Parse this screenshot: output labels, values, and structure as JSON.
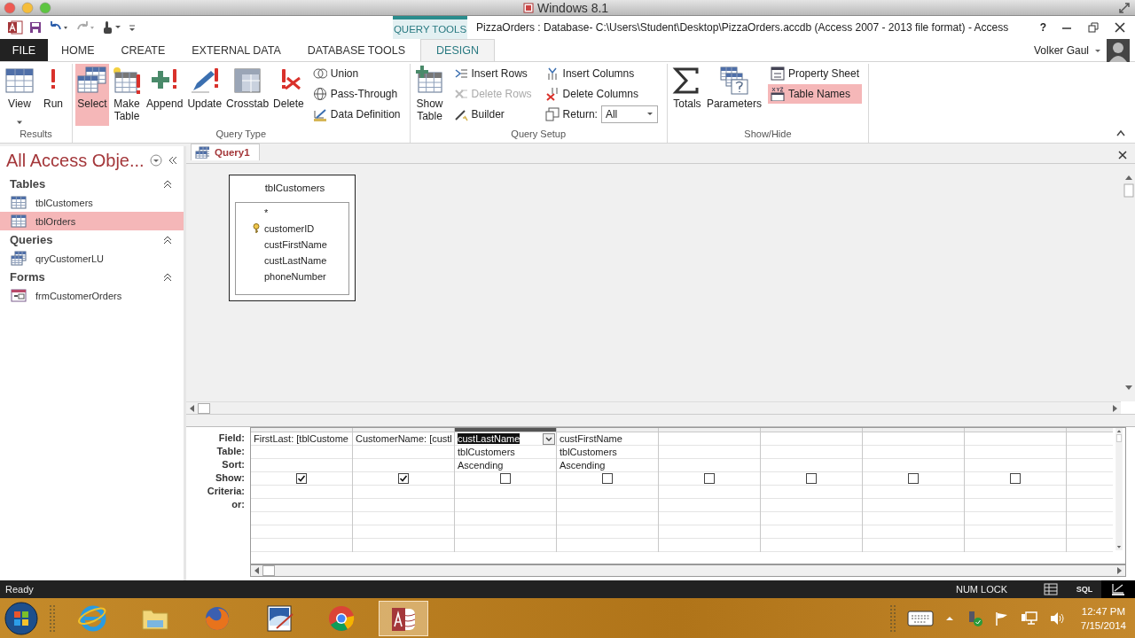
{
  "host_window": {
    "title": "Windows 8.1"
  },
  "title_bar": {
    "context_label": "QUERY TOOLS",
    "title": "PizzaOrders : Database- C:\\Users\\Student\\Desktop\\PizzaOrders.accdb (Access 2007 - 2013 file format) - Access",
    "help": "?"
  },
  "tabs": [
    {
      "label": "FILE",
      "kind": "file",
      "selected": false
    },
    {
      "label": "HOME",
      "kind": "normal",
      "selected": false
    },
    {
      "label": "CREATE",
      "kind": "normal",
      "selected": false
    },
    {
      "label": "EXTERNAL DATA",
      "kind": "normal",
      "selected": false
    },
    {
      "label": "DATABASE TOOLS",
      "kind": "normal",
      "selected": false
    },
    {
      "label": "DESIGN",
      "kind": "context",
      "selected": true
    }
  ],
  "account": {
    "user": "Volker Gaul"
  },
  "ribbon": {
    "groups": [
      {
        "label": "Results",
        "controls": [
          {
            "kind": "large",
            "label": "View",
            "dropdown": true,
            "selected": false,
            "disabled": false
          },
          {
            "kind": "large",
            "label": "Run",
            "dropdown": false,
            "selected": false,
            "disabled": false
          }
        ]
      },
      {
        "label": "Query Type",
        "controls": [
          {
            "kind": "large",
            "label": "Select",
            "dropdown": false,
            "selected": true,
            "disabled": false
          },
          {
            "kind": "large",
            "label": "Make Table",
            "dropdown": false,
            "selected": false,
            "disabled": false
          },
          {
            "kind": "large",
            "label": "Append",
            "dropdown": false,
            "selected": false,
            "disabled": false
          },
          {
            "kind": "large",
            "label": "Update",
            "dropdown": false,
            "selected": false,
            "disabled": false
          },
          {
            "kind": "large",
            "label": "Crosstab",
            "dropdown": false,
            "selected": false,
            "disabled": false
          },
          {
            "kind": "large",
            "label": "Delete",
            "dropdown": false,
            "selected": false,
            "disabled": false
          },
          {
            "kind": "stack",
            "items": [
              {
                "kind": "small",
                "label": "Union",
                "selected": false,
                "disabled": false
              },
              {
                "kind": "small",
                "label": "Pass-Through",
                "selected": false,
                "disabled": false
              },
              {
                "kind": "small",
                "label": "Data Definition",
                "selected": false,
                "disabled": false
              }
            ]
          }
        ]
      },
      {
        "label": "Query Setup",
        "controls": [
          {
            "kind": "large",
            "label": "Show Table",
            "dropdown": false,
            "selected": false,
            "disabled": false
          },
          {
            "kind": "stack",
            "items": [
              {
                "kind": "small",
                "label": "Insert Rows",
                "selected": false,
                "disabled": false
              },
              {
                "kind": "small",
                "label": "Delete Rows",
                "selected": false,
                "disabled": true
              },
              {
                "kind": "small",
                "label": "Builder",
                "selected": false,
                "disabled": false
              }
            ]
          },
          {
            "kind": "stack",
            "items": [
              {
                "kind": "small",
                "label": "Insert Columns",
                "selected": false,
                "disabled": false
              },
              {
                "kind": "small",
                "label": "Delete Columns",
                "selected": false,
                "disabled": false
              },
              {
                "kind": "dropdown",
                "label": "Return:",
                "value": "All",
                "selected": false,
                "disabled": false
              }
            ]
          }
        ]
      },
      {
        "label": "Show/Hide",
        "controls": [
          {
            "kind": "large",
            "label": "Totals",
            "dropdown": false,
            "selected": false,
            "disabled": false
          },
          {
            "kind": "large",
            "label": "Parameters",
            "dropdown": false,
            "selected": false,
            "disabled": false
          },
          {
            "kind": "stack",
            "items": [
              {
                "kind": "small",
                "label": "Property Sheet",
                "selected": false,
                "disabled": false
              },
              {
                "kind": "small",
                "label": "Table Names",
                "selected": true,
                "disabled": false
              }
            ]
          }
        ]
      }
    ]
  },
  "nav_pane": {
    "title": "All Access Obje...",
    "sections": [
      {
        "label": "Tables",
        "expanded": true,
        "items": [
          {
            "kind": "table",
            "label": "tblCustomers",
            "selected": false
          },
          {
            "kind": "table",
            "label": "tblOrders",
            "selected": true
          }
        ]
      },
      {
        "label": "Queries",
        "expanded": true,
        "items": [
          {
            "kind": "query",
            "label": "qryCustomerLU",
            "selected": false
          }
        ]
      },
      {
        "label": "Forms",
        "expanded": true,
        "items": [
          {
            "kind": "form",
            "label": "frmCustomerOrders",
            "selected": false
          }
        ]
      }
    ]
  },
  "document_tabs": [
    {
      "label": "Query1",
      "selected": true
    }
  ],
  "field_lists": [
    {
      "title": "tblCustomers",
      "fields": [
        {
          "name": "*",
          "primary_key": false
        },
        {
          "name": "customerID",
          "primary_key": true
        },
        {
          "name": "custFirstName",
          "primary_key": false
        },
        {
          "name": "custLastName",
          "primary_key": false
        },
        {
          "name": "phoneNumber",
          "primary_key": false
        }
      ]
    }
  ],
  "grid": {
    "row_labels": [
      "Field:",
      "Table:",
      "Sort:",
      "Show:",
      "Criteria:",
      "or:"
    ],
    "columns": [
      {
        "field": "FirstLast: [tblCustome",
        "show": true,
        "selected": false
      },
      {
        "field": "CustomerName: [custl",
        "show": true,
        "selected": false
      },
      {
        "field": "custLastName",
        "table": "tblCustomers",
        "sort": "Ascending",
        "show": false,
        "selected": true
      },
      {
        "field": "custFirstName",
        "table": "tblCustomers",
        "sort": "Ascending",
        "show": false,
        "selected": false
      },
      {
        "show": false,
        "selected": false
      },
      {
        "show": false,
        "selected": false
      },
      {
        "show": false,
        "selected": false
      },
      {
        "show": false,
        "selected": false
      }
    ]
  },
  "status_bar": {
    "text": "Ready",
    "indicator": "NUM LOCK",
    "views": [
      {
        "kind": "datasheet",
        "selected": false
      },
      {
        "kind": "sql",
        "label": "SQL",
        "selected": false
      },
      {
        "kind": "design",
        "selected": true
      }
    ]
  },
  "taskbar": {
    "apps": [
      {
        "kind": "ie",
        "selected": false
      },
      {
        "kind": "explorer",
        "selected": false
      },
      {
        "kind": "firefox",
        "selected": false
      },
      {
        "kind": "paint",
        "selected": false
      },
      {
        "kind": "chrome",
        "selected": false
      },
      {
        "kind": "access",
        "selected": true
      }
    ],
    "time": "12:47 PM",
    "date": "7/15/2014"
  }
}
